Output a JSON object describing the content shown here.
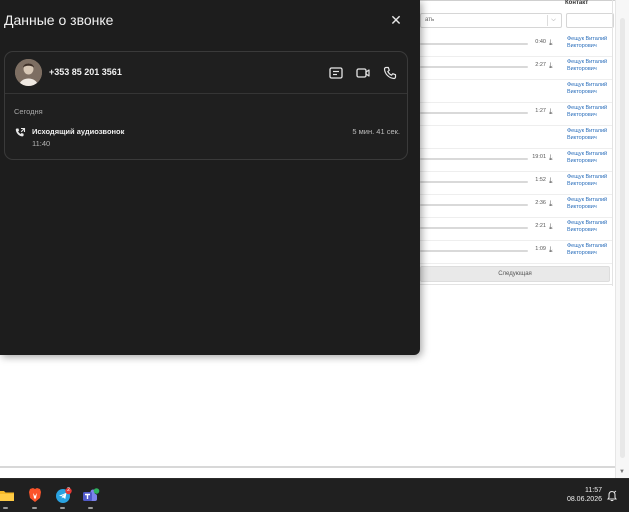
{
  "background_page": {
    "header": {
      "contact_label": "Контакт"
    },
    "filter": {
      "select_value": "ать"
    },
    "rows": [
      {
        "duration": "0:40",
        "contact": "Фещук Виталий Викторович"
      },
      {
        "duration": "2:27",
        "contact": "Фещук Виталий Викторович"
      },
      {
        "duration": "",
        "contact": "Фещук Виталий Викторович"
      },
      {
        "duration": "1:27",
        "contact": "Фещук Виталий Викторович"
      },
      {
        "duration": "",
        "contact": "Фещук Виталий Викторович"
      },
      {
        "duration": "19:01",
        "contact": "Фещук Виталий Викторович"
      },
      {
        "duration": "1:52",
        "contact": "Фещук Виталий Викторович"
      },
      {
        "duration": "2:36",
        "contact": "Фещук Виталий Викторович"
      },
      {
        "duration": "2:21",
        "contact": "Фещук Виталий Викторович"
      },
      {
        "duration": "1:09",
        "contact": "Фещук Виталий Викторович"
      }
    ],
    "next_button_label": "Следующая"
  },
  "panel": {
    "title": "Данные о звонке",
    "close_icon": "close-icon",
    "contact": {
      "phone": "+353 85 201 3561",
      "actions": [
        "message-icon",
        "video-call-icon",
        "phone-icon"
      ]
    },
    "section_label": "Сегодня",
    "calls": [
      {
        "type": "Исходящий аудиозвонок",
        "time": "11:40",
        "duration": "5 мин. 41 сек.",
        "icon": "outgoing-call-icon"
      }
    ]
  },
  "taskbar": {
    "apps": [
      {
        "name": "file-explorer",
        "icon": "folder-icon"
      },
      {
        "name": "brave-browser",
        "icon": "brave-lion-icon"
      },
      {
        "name": "telegram",
        "icon": "telegram-icon",
        "badge": "2"
      },
      {
        "name": "teams",
        "icon": "teams-icon"
      }
    ],
    "clock": {
      "time": "11:57",
      "date": "08.06.2026"
    },
    "notification_icon": "notification-bell-icon"
  },
  "colors": {
    "panel_bg": "#1d1d1d",
    "card_border": "#3a3a3a",
    "link_blue": "#2a6ebb",
    "taskbar_bg": "#202020"
  }
}
